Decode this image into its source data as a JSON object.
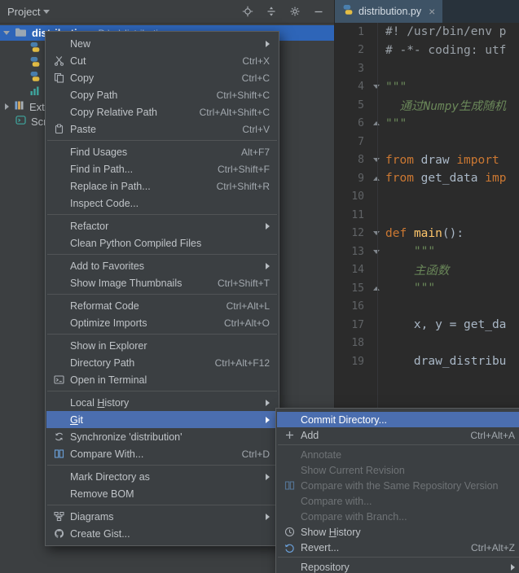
{
  "colors": {
    "selection_blue": "#4b6eaf",
    "tree_selection": "#2e65b8",
    "keyword_orange": "#cc7832",
    "string_green": "#6a8759",
    "function_yellow": "#ffc66b",
    "panel_bg": "#3c3f41",
    "editor_bg": "#2b2b2b"
  },
  "project_panel": {
    "header": {
      "title": "Project"
    },
    "tree": {
      "root": {
        "name": "distribution",
        "path": "D:\\...\\distribution"
      },
      "external_label": "External Libraries",
      "scratches_label": "Scratches and Consoles"
    }
  },
  "editor": {
    "tab": {
      "title": "distribution.py",
      "close_glyph": "×"
    },
    "lines": [
      {
        "num": "1",
        "segs": [
          {
            "t": "#! /usr/bin/env p"
          }
        ]
      },
      {
        "num": "2",
        "segs": [
          {
            "t": "# -*- coding: utf"
          }
        ]
      },
      {
        "num": "3",
        "segs": []
      },
      {
        "num": "4",
        "segs": [
          {
            "t": "\"\"\""
          }
        ]
      },
      {
        "num": "5",
        "segs": [
          {
            "t": "  通过Numpy生成随机"
          }
        ]
      },
      {
        "num": "6",
        "segs": [
          {
            "t": "\"\"\""
          }
        ]
      },
      {
        "num": "7",
        "segs": []
      },
      {
        "num": "8",
        "segs": [
          {
            "t": "from"
          },
          {
            "t": " draw "
          },
          {
            "t": "import"
          }
        ]
      },
      {
        "num": "9",
        "segs": [
          {
            "t": "from"
          },
          {
            "t": " get_data "
          },
          {
            "t": "imp"
          }
        ]
      },
      {
        "num": "10",
        "segs": []
      },
      {
        "num": "11",
        "segs": []
      },
      {
        "num": "12",
        "segs": [
          {
            "t": "def"
          },
          {
            "t": " "
          },
          {
            "t": "main"
          },
          {
            "t": "():"
          }
        ]
      },
      {
        "num": "13",
        "segs": [
          {
            "t": "    \"\"\""
          }
        ]
      },
      {
        "num": "14",
        "segs": [
          {
            "t": "    主函数"
          }
        ]
      },
      {
        "num": "15",
        "segs": [
          {
            "t": "    \"\"\""
          }
        ]
      },
      {
        "num": "16",
        "segs": []
      },
      {
        "num": "17",
        "segs": [
          {
            "t": "    x, y = get_da"
          }
        ]
      },
      {
        "num": "18",
        "segs": []
      },
      {
        "num": "19",
        "segs": [
          {
            "t": "    draw_distribu"
          }
        ]
      }
    ]
  },
  "context_menu": {
    "items": [
      {
        "label": "New",
        "has_submenu": true
      },
      {
        "label": "Cut",
        "shortcut": "Ctrl+X",
        "icon": "scissors-icon"
      },
      {
        "label": "Copy",
        "shortcut": "Ctrl+C",
        "icon": "copy-icon"
      },
      {
        "label": "Copy Path",
        "shortcut": "Ctrl+Shift+C"
      },
      {
        "label": "Copy Relative Path",
        "shortcut": "Ctrl+Alt+Shift+C"
      },
      {
        "label": "Paste",
        "shortcut": "Ctrl+V",
        "icon": "paste-icon"
      },
      {
        "type": "separator"
      },
      {
        "label": "Find Usages",
        "shortcut": "Alt+F7"
      },
      {
        "label": "Find in Path...",
        "shortcut": "Ctrl+Shift+F"
      },
      {
        "label": "Replace in Path...",
        "shortcut": "Ctrl+Shift+R"
      },
      {
        "label": "Inspect Code..."
      },
      {
        "type": "separator"
      },
      {
        "label": "Refactor",
        "has_submenu": true
      },
      {
        "label": "Clean Python Compiled Files"
      },
      {
        "type": "separator"
      },
      {
        "label": "Add to Favorites",
        "has_submenu": true
      },
      {
        "label": "Show Image Thumbnails",
        "shortcut": "Ctrl+Shift+T"
      },
      {
        "type": "separator"
      },
      {
        "label": "Reformat Code",
        "shortcut": "Ctrl+Alt+L"
      },
      {
        "label": "Optimize Imports",
        "shortcut": "Ctrl+Alt+O"
      },
      {
        "type": "separator"
      },
      {
        "label": "Show in Explorer"
      },
      {
        "label": "Directory Path",
        "shortcut": "Ctrl+Alt+F12"
      },
      {
        "label": "Open in Terminal",
        "icon": "terminal-icon"
      },
      {
        "type": "separator"
      },
      {
        "label": "Local History",
        "has_submenu": true,
        "mnemonic": "H"
      },
      {
        "label": "Git",
        "has_submenu": true,
        "selected": true,
        "mnemonic": "G"
      },
      {
        "label": "Synchronize 'distribution'",
        "icon": "sync-icon"
      },
      {
        "label": "Compare With...",
        "shortcut": "Ctrl+D",
        "icon": "compare-icon"
      },
      {
        "type": "separator"
      },
      {
        "label": "Mark Directory as",
        "has_submenu": true
      },
      {
        "label": "Remove BOM"
      },
      {
        "type": "separator"
      },
      {
        "label": "Diagrams",
        "has_submenu": true,
        "icon": "diagram-icon"
      },
      {
        "label": "Create Gist...",
        "icon": "github-icon"
      }
    ]
  },
  "git_submenu": {
    "items": [
      {
        "label": "Commit Directory...",
        "selected": true
      },
      {
        "label": "Add",
        "shortcut": "Ctrl+Alt+A",
        "icon": "plus-icon"
      },
      {
        "type": "separator"
      },
      {
        "label": "Annotate",
        "disabled": true
      },
      {
        "label": "Show Current Revision",
        "disabled": true
      },
      {
        "label": "Compare with the Same Repository Version",
        "disabled": true,
        "icon": "compare-icon"
      },
      {
        "label": "Compare with...",
        "disabled": true
      },
      {
        "label": "Compare with Branch...",
        "disabled": true
      },
      {
        "label": "Show History",
        "icon": "history-icon",
        "mnemonic": "H"
      },
      {
        "label": "Revert...",
        "shortcut": "Ctrl+Alt+Z",
        "icon": "revert-icon"
      },
      {
        "type": "separator"
      },
      {
        "label": "Repository",
        "has_submenu": true
      }
    ]
  }
}
